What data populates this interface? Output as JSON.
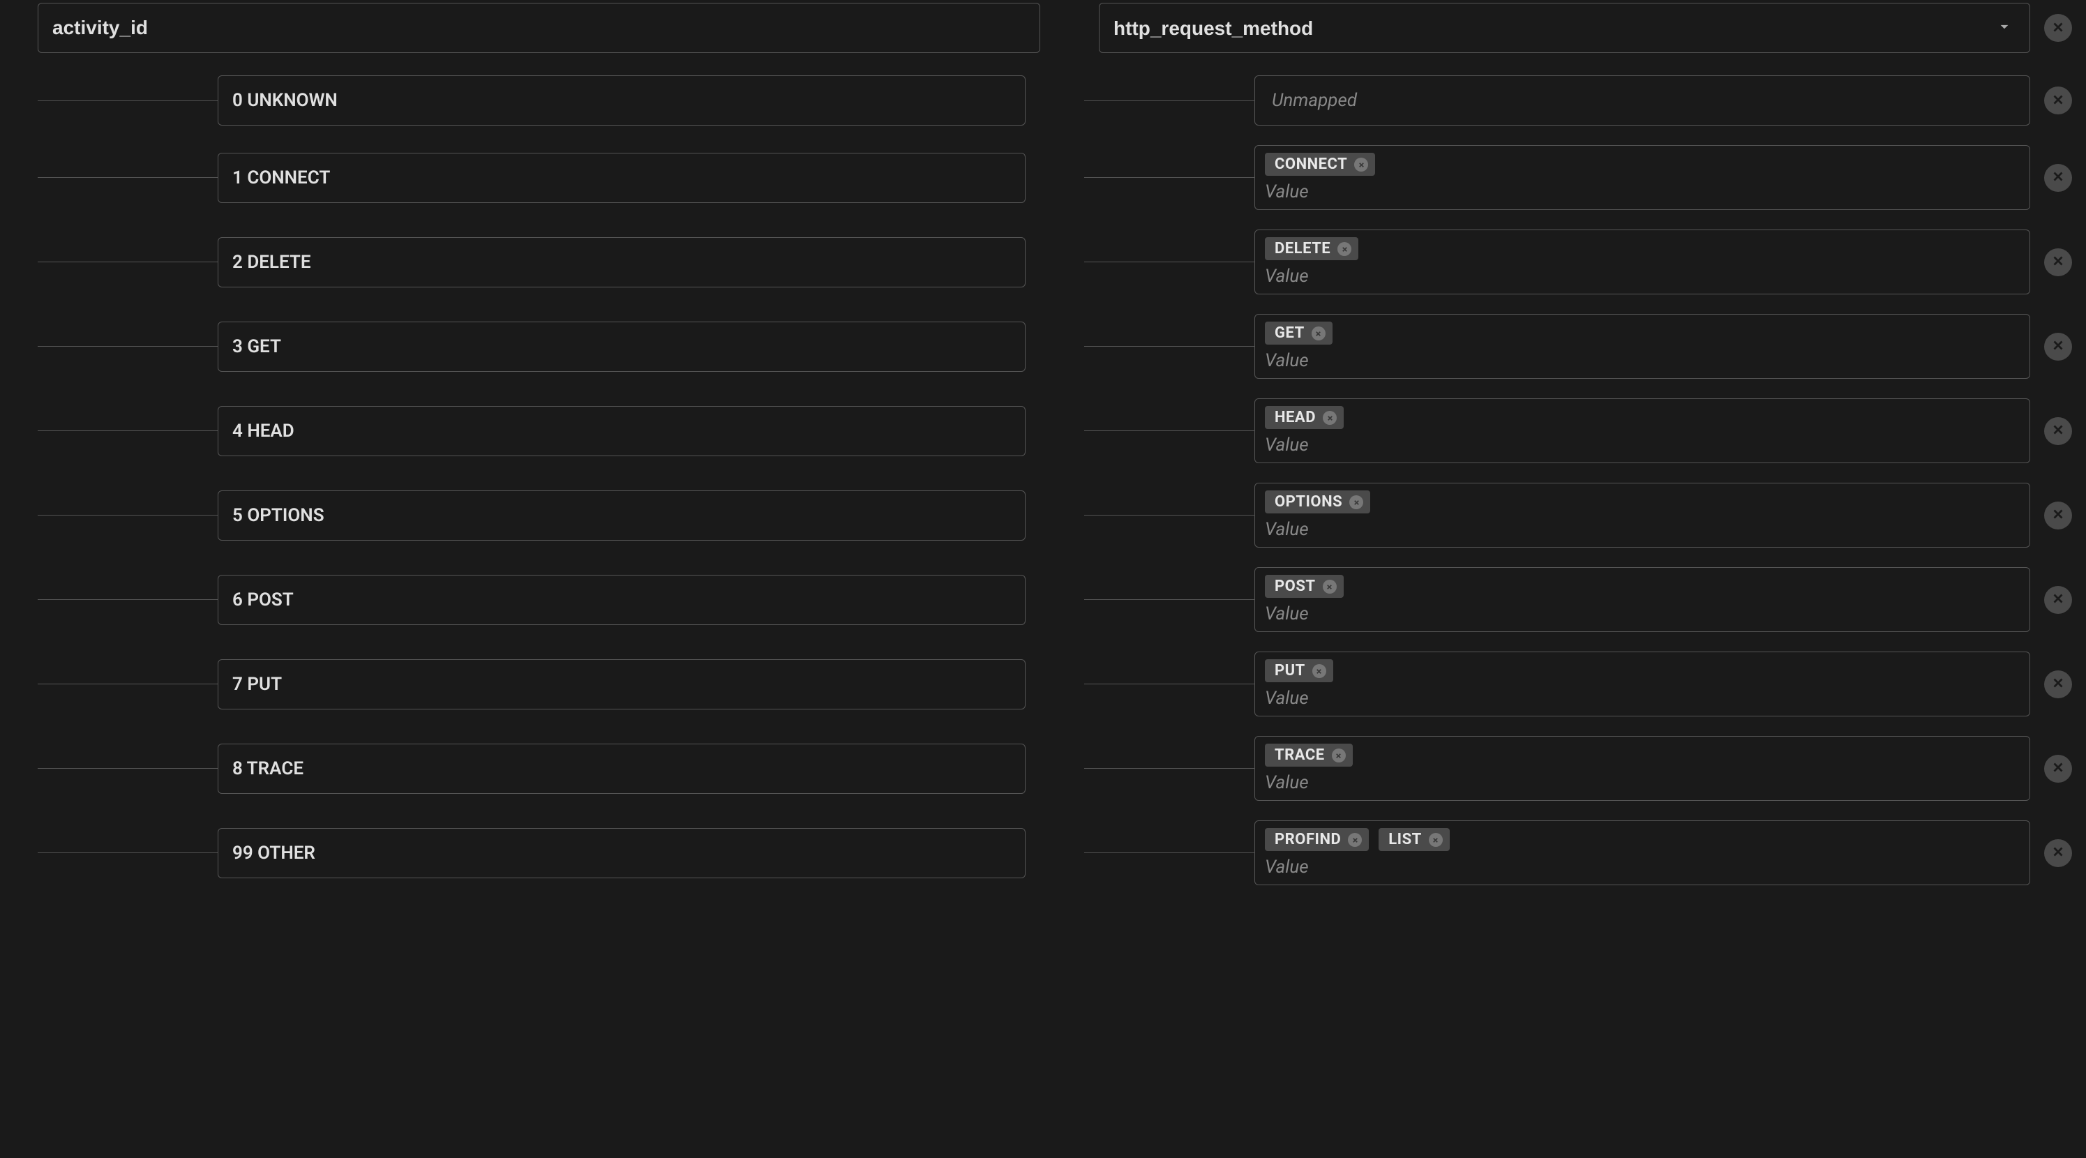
{
  "header": {
    "left_field": "activity_id",
    "right_field": "http_request_method"
  },
  "placeholders": {
    "value": "Value",
    "unmapped": "Unmapped"
  },
  "rows": [
    {
      "id": "row-0",
      "left": "0 UNKNOWN",
      "tags": [],
      "unmapped": true,
      "has_value_line": false
    },
    {
      "id": "row-1",
      "left": "1 CONNECT",
      "tags": [
        "CONNECT"
      ],
      "unmapped": false,
      "has_value_line": true
    },
    {
      "id": "row-2",
      "left": "2 DELETE",
      "tags": [
        "DELETE"
      ],
      "unmapped": false,
      "has_value_line": true
    },
    {
      "id": "row-3",
      "left": "3 GET",
      "tags": [
        "GET"
      ],
      "unmapped": false,
      "has_value_line": true
    },
    {
      "id": "row-4",
      "left": "4 HEAD",
      "tags": [
        "HEAD"
      ],
      "unmapped": false,
      "has_value_line": true
    },
    {
      "id": "row-5",
      "left": "5 OPTIONS",
      "tags": [
        "OPTIONS"
      ],
      "unmapped": false,
      "has_value_line": true
    },
    {
      "id": "row-6",
      "left": "6 POST",
      "tags": [
        "POST"
      ],
      "unmapped": false,
      "has_value_line": true
    },
    {
      "id": "row-7",
      "left": "7 PUT",
      "tags": [
        "PUT"
      ],
      "unmapped": false,
      "has_value_line": true
    },
    {
      "id": "row-8",
      "left": "8 TRACE",
      "tags": [
        "TRACE"
      ],
      "unmapped": false,
      "has_value_line": true
    },
    {
      "id": "row-9",
      "left": "99 OTHER",
      "tags": [
        "PROFIND",
        "LIST"
      ],
      "unmapped": false,
      "has_value_line": true
    }
  ]
}
